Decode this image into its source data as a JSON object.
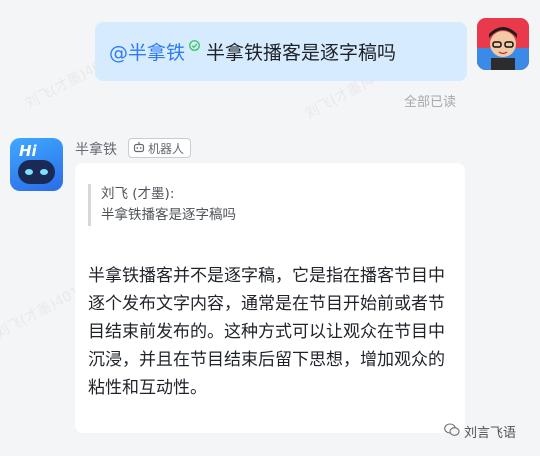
{
  "user_message": {
    "mention": "@半拿铁",
    "text": "半拿铁播客是逐字稿吗",
    "read_status": "全部已读"
  },
  "bot": {
    "name": "半拿铁",
    "badge": "机器人",
    "avatar_text": "Hi",
    "quote": {
      "author": "刘飞 (才墨):",
      "text": "半拿铁播客是逐字稿吗"
    },
    "answer": "半拿铁播客并不是逐字稿，它是指在播客节目中逐个发布文字内容，通常是在节目开始前或者节目结束前发布的。这种方式可以让观众在节目中沉浸，并且在节目结束后留下思想，增加观众的粘性和互动性。"
  },
  "signature": "刘言飞语",
  "watermark": "刘飞(才墨)4016",
  "colors": {
    "user_bubble": "#d6ebfd",
    "mention": "#2f7bf6",
    "bot_avatar": "#2b6be9"
  }
}
